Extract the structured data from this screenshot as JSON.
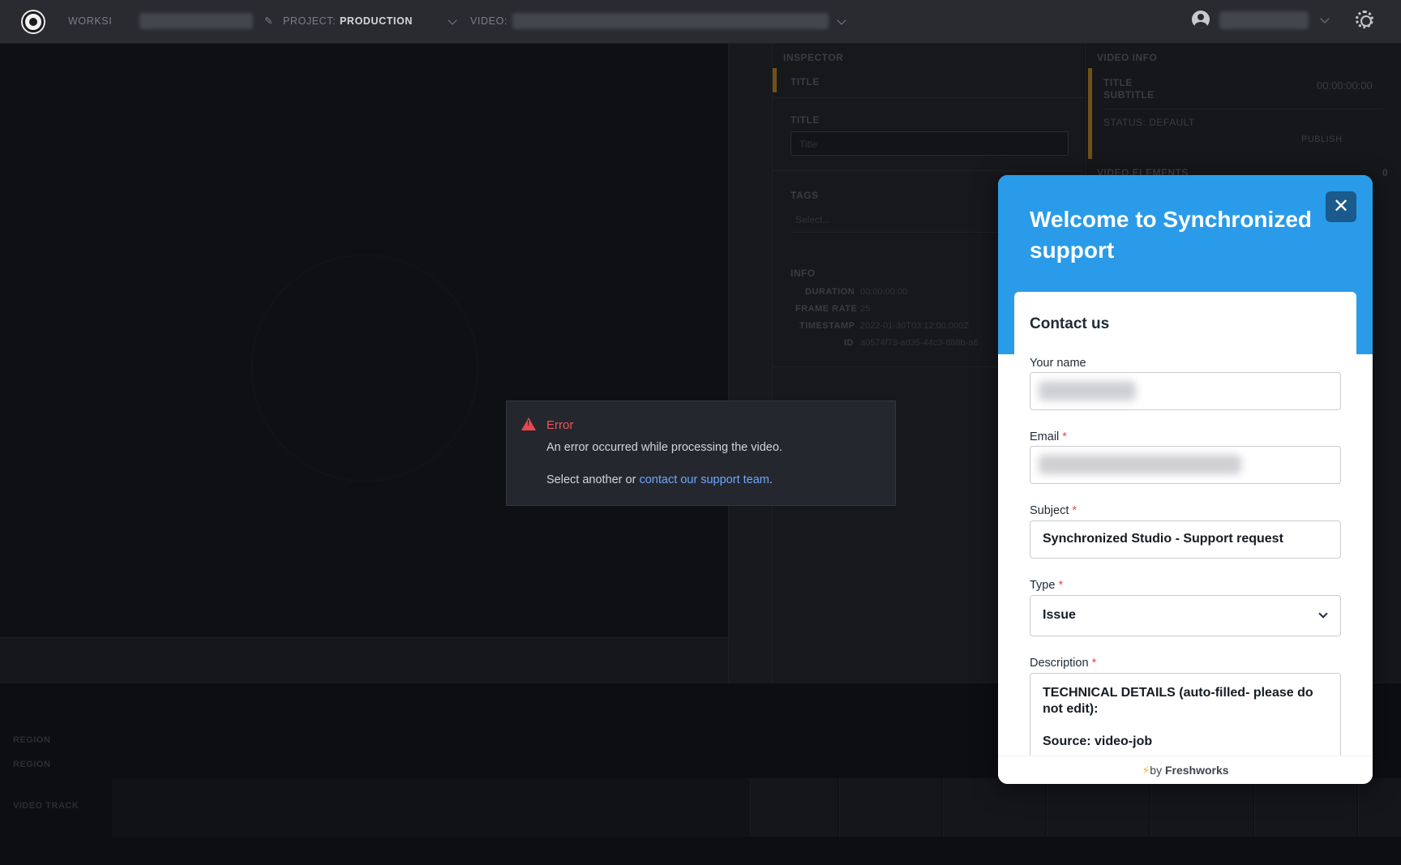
{
  "topbar": {
    "workspace_label": "WORKSI",
    "project_label": "PROJECT:",
    "project_value": "PRODUCTION",
    "video_label": "VIDEO:"
  },
  "inspector": {
    "header": "INSPECTOR",
    "tab_title": "TITLE",
    "title_label": "TITLE",
    "title_placeholder": "Title",
    "tags_label": "TAGS",
    "tags_placeholder": "Select...",
    "info_label": "INFO",
    "info_rows": [
      {
        "key": "DURATION",
        "value": "00:00:00:00"
      },
      {
        "key": "FRAME RATE",
        "value": "25"
      },
      {
        "key": "TIMESTAMP",
        "value": "2022-01-30T03:12:00.000Z"
      },
      {
        "key": "ID",
        "value": "a0574f73-ad35-44c3-888b-a6"
      }
    ]
  },
  "video_info": {
    "header": "VIDEO INFO",
    "title": "TITLE",
    "subtitle": "SUBTITLE",
    "timecode": "00:00:00:00",
    "status": "STATUS: DEFAULT",
    "publish": "PUBLISH",
    "elements_label": "VIDEO ELEMENTS",
    "elements_count": "0"
  },
  "timeline": {
    "region_1": "REGION",
    "region_2": "REGION",
    "video_track": "VIDEO TRACK"
  },
  "error": {
    "title": "Error",
    "message": "An error occurred while processing the video.",
    "action_prefix": "Select another or ",
    "action_link": "contact our support team",
    "action_suffix": "."
  },
  "support_widget": {
    "title": "Welcome to Synchronized support",
    "close_label": "✕",
    "card_title": "Contact us",
    "name_label": "Your name",
    "email_label": "Email",
    "subject_label": "Subject",
    "subject_value": "Synchronized Studio - Support request",
    "type_label": "Type",
    "type_value": "Issue",
    "description_label": "Description",
    "description_line_1": "TECHNICAL DETAILS (auto-filled- please do not edit):",
    "description_line_2": "Source: video-job",
    "required_mark": "*",
    "footer_prefix": "by ",
    "footer_brand": "Freshworks"
  }
}
